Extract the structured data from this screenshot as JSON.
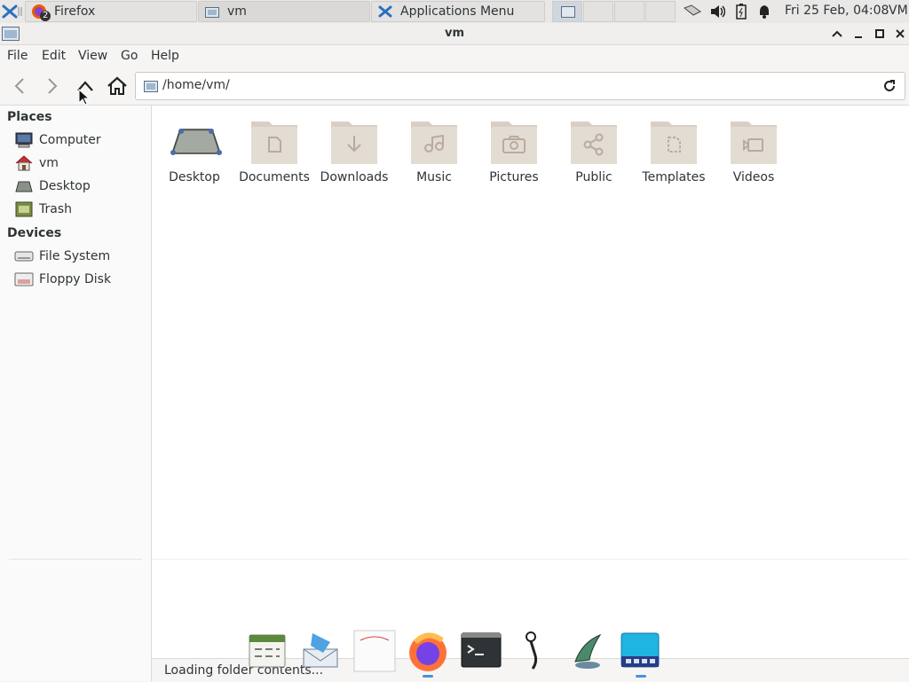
{
  "panel": {
    "tasks": [
      {
        "label": "Firefox",
        "badge": "2"
      },
      {
        "label": "vm"
      },
      {
        "label": "Applications Menu"
      }
    ],
    "clock": "Fri 25 Feb, 04:08",
    "user": "VM"
  },
  "window": {
    "title": "vm"
  },
  "menubar": [
    "File",
    "Edit",
    "View",
    "Go",
    "Help"
  ],
  "location": {
    "path": "/home/vm/"
  },
  "sidebar": {
    "places_heading": "Places",
    "places": [
      {
        "label": "Computer",
        "icon": "computer-icon"
      },
      {
        "label": "vm",
        "icon": "home-icon"
      },
      {
        "label": "Desktop",
        "icon": "desktop-icon"
      },
      {
        "label": "Trash",
        "icon": "trash-icon"
      }
    ],
    "devices_heading": "Devices",
    "devices": [
      {
        "label": "File System",
        "icon": "drive-icon"
      },
      {
        "label": "Floppy Disk",
        "icon": "floppy-icon"
      }
    ]
  },
  "files": [
    {
      "label": "Desktop",
      "icon": "desktop-folder-icon"
    },
    {
      "label": "Documents",
      "icon": "document-icon"
    },
    {
      "label": "Downloads",
      "icon": "download-icon"
    },
    {
      "label": "Music",
      "icon": "music-icon"
    },
    {
      "label": "Pictures",
      "icon": "camera-icon"
    },
    {
      "label": "Public",
      "icon": "share-icon"
    },
    {
      "label": "Templates",
      "icon": "template-icon"
    },
    {
      "label": "Videos",
      "icon": "video-icon"
    }
  ],
  "status": "Loading folder contents...",
  "dock": [
    {
      "name": "calendar"
    },
    {
      "name": "mail"
    },
    {
      "name": "notes"
    },
    {
      "name": "firefox"
    },
    {
      "name": "terminal"
    },
    {
      "name": "audio"
    },
    {
      "name": "network"
    },
    {
      "name": "workspaces"
    }
  ],
  "colors": {
    "folder": "#e3dcd3",
    "folder_tab": "#d8cfc4",
    "folder_glyph": "#b9ab9c",
    "accent": "#4a90d9"
  }
}
